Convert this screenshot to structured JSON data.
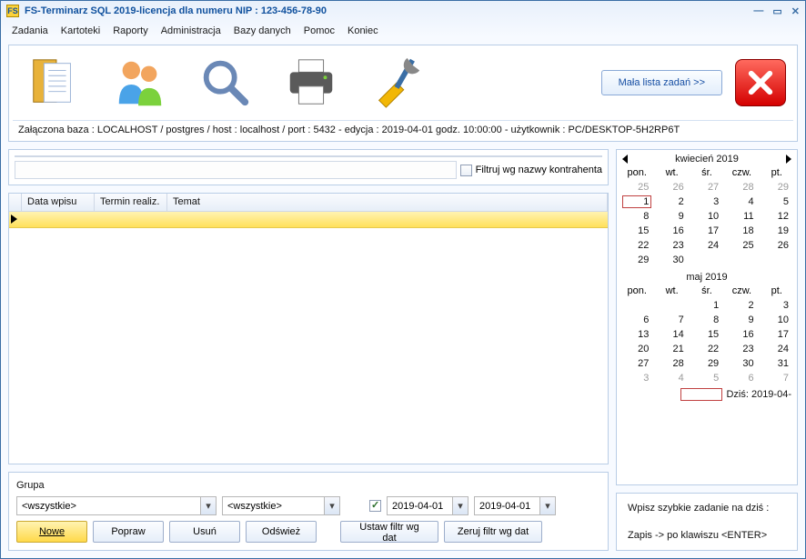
{
  "title": {
    "app": "FS-Terminarz SQL 2019",
    "sep": "     -     ",
    "license": "licencja dla numeru NIP    :   123-456-78-90"
  },
  "menu": [
    "Zadania",
    "Kartoteki",
    "Raporty",
    "Administracja",
    "Bazy danych",
    "Pomoc",
    "Koniec"
  ],
  "toolbar": {
    "small_list_btn": "Mała lista zadań >>"
  },
  "status": "Załączona baza : LOCALHOST  /  postgres /  host : localhost  /  port : 5432   -    edycja : 2019-04-01  godz. 10:00:00    -    użytkownik : PC/DESKTOP-5H2RP6T",
  "filter": {
    "checkbox_label": "Filtruj wg nazwy kontrahenta"
  },
  "grid": {
    "cols": [
      "Data wpisu",
      "Termin realiz.",
      "Temat"
    ]
  },
  "group": {
    "label": "Grupa",
    "combo1": "<wszystkie>",
    "combo2": "<wszystkie>",
    "date1": "2019-04-01",
    "date2": "2019-04-01"
  },
  "buttons": {
    "nowe": "Nowe",
    "popraw": "Popraw",
    "usun": "Usuń",
    "odswiez": "Odśwież",
    "ustaw": "Ustaw filtr wg dat",
    "zeruj": "Zeruj filtr wg dat"
  },
  "calendar": {
    "month1": "kwiecień 2019",
    "month2": "maj 2019",
    "daynames": [
      "pon.",
      "wt.",
      "śr.",
      "czw.",
      "pt."
    ],
    "m1_rows": [
      [
        {
          "d": "25",
          "o": true
        },
        {
          "d": "26",
          "o": true
        },
        {
          "d": "27",
          "o": true
        },
        {
          "d": "28",
          "o": true
        },
        {
          "d": "29",
          "o": true
        }
      ],
      [
        {
          "d": "1",
          "today": true
        },
        {
          "d": "2"
        },
        {
          "d": "3"
        },
        {
          "d": "4"
        },
        {
          "d": "5"
        }
      ],
      [
        {
          "d": "8"
        },
        {
          "d": "9"
        },
        {
          "d": "10"
        },
        {
          "d": "11"
        },
        {
          "d": "12"
        }
      ],
      [
        {
          "d": "15"
        },
        {
          "d": "16"
        },
        {
          "d": "17"
        },
        {
          "d": "18"
        },
        {
          "d": "19"
        }
      ],
      [
        {
          "d": "22"
        },
        {
          "d": "23"
        },
        {
          "d": "24"
        },
        {
          "d": "25"
        },
        {
          "d": "26"
        }
      ],
      [
        {
          "d": "29"
        },
        {
          "d": "30"
        },
        {
          "d": ""
        },
        {
          "d": ""
        },
        {
          "d": ""
        }
      ]
    ],
    "m2_rows": [
      [
        {
          "d": ""
        },
        {
          "d": ""
        },
        {
          "d": "1"
        },
        {
          "d": "2"
        },
        {
          "d": "3"
        }
      ],
      [
        {
          "d": "6"
        },
        {
          "d": "7"
        },
        {
          "d": "8"
        },
        {
          "d": "9"
        },
        {
          "d": "10"
        }
      ],
      [
        {
          "d": "13"
        },
        {
          "d": "14"
        },
        {
          "d": "15"
        },
        {
          "d": "16"
        },
        {
          "d": "17"
        }
      ],
      [
        {
          "d": "20"
        },
        {
          "d": "21"
        },
        {
          "d": "22"
        },
        {
          "d": "23"
        },
        {
          "d": "24"
        }
      ],
      [
        {
          "d": "27"
        },
        {
          "d": "28"
        },
        {
          "d": "29"
        },
        {
          "d": "30"
        },
        {
          "d": "31"
        }
      ],
      [
        {
          "d": "3",
          "o": true
        },
        {
          "d": "4",
          "o": true
        },
        {
          "d": "5",
          "o": true
        },
        {
          "d": "6",
          "o": true
        },
        {
          "d": "7",
          "o": true
        }
      ]
    ],
    "today_label": "Dziś: 2019-04-"
  },
  "quick": {
    "title": "Wpisz szybkie zadanie na dziś :",
    "hint": "Zapis ->   po klawiszu  <ENTER>"
  }
}
